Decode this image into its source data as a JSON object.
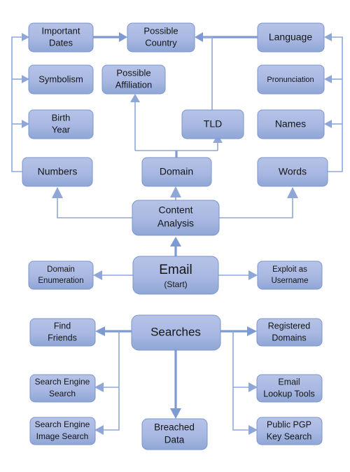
{
  "diagram": {
    "title": "Email OSINT Investigation Flowchart",
    "type": "flowchart",
    "background_color": "#ffffff",
    "node_fill_top": "#b3c1e6",
    "node_fill_bottom": "#93a9d7",
    "node_stroke": "#7b95cf",
    "connector_color": "#8fa7d6",
    "text_color": "#151515",
    "nodes": {
      "important_dates": {
        "label": "Important\nDates",
        "line1": "Important",
        "line2": "Dates"
      },
      "possible_country": {
        "label": "Possible\nCountry",
        "line1": "Possible",
        "line2": "Country"
      },
      "language": {
        "label": "Language",
        "line1": "Language",
        "line2": ""
      },
      "symbolism": {
        "label": "Symbolism",
        "line1": "Symbolism",
        "line2": ""
      },
      "possible_affiliation": {
        "label": "Possible\nAffiliation",
        "line1": "Possible",
        "line2": "Affiliation"
      },
      "pronunciation": {
        "label": "Pronunciation",
        "line1": "Pronunciation",
        "line2": ""
      },
      "birth_year": {
        "label": "Birth\nYear",
        "line1": "Birth",
        "line2": "Year"
      },
      "tld": {
        "label": "TLD",
        "line1": "TLD",
        "line2": ""
      },
      "names": {
        "label": "Names",
        "line1": "Names",
        "line2": ""
      },
      "numbers": {
        "label": "Numbers",
        "line1": "Numbers",
        "line2": ""
      },
      "domain": {
        "label": "Domain",
        "line1": "Domain",
        "line2": ""
      },
      "words": {
        "label": "Words",
        "line1": "Words",
        "line2": ""
      },
      "content_analysis": {
        "label": "Content\nAnalysis",
        "line1": "Content",
        "line2": "Analysis"
      },
      "domain_enumeration": {
        "label": "Domain\nEnumeration",
        "line1": "Domain",
        "line2": "Enumeration"
      },
      "email": {
        "label": "Email\n(Start)",
        "line1": "Email",
        "line2": "(Start)"
      },
      "exploit_as_username": {
        "label": "Exploit as\nUsername",
        "line1": "Exploit  as",
        "line2": "Username"
      },
      "find_friends": {
        "label": "Find\nFriends",
        "line1": "Find",
        "line2": "Friends"
      },
      "searches": {
        "label": "Searches",
        "line1": "Searches",
        "line2": ""
      },
      "registered_domains": {
        "label": "Registered\nDomains",
        "line1": "Registered",
        "line2": "Domains"
      },
      "search_engine_search": {
        "label": "Search Engine\nSearch",
        "line1": "Search Engine",
        "line2": "Search"
      },
      "email_lookup_tools": {
        "label": "Email\nLookup Tools",
        "line1": "Email",
        "line2": "Lookup Tools"
      },
      "search_engine_image_search": {
        "label": "Search Engine\nImage Search",
        "line1": "Search Engine",
        "line2": "Image Search"
      },
      "breached_data": {
        "label": "Breached\nData",
        "line1": "Breached",
        "line2": "Data"
      },
      "public_pgp_key_search": {
        "label": "Public PGP\nKey Search",
        "line1": "Public PGP",
        "line2": "Key Search"
      }
    },
    "edges": [
      {
        "from": "important_dates",
        "to": "possible_country"
      },
      {
        "from": "language",
        "to": "possible_country"
      },
      {
        "from": "tld",
        "to": "possible_country"
      },
      {
        "from": "numbers",
        "to": "important_dates"
      },
      {
        "from": "numbers",
        "to": "symbolism"
      },
      {
        "from": "numbers",
        "to": "birth_year"
      },
      {
        "from": "words",
        "to": "language"
      },
      {
        "from": "words",
        "to": "pronunciation"
      },
      {
        "from": "words",
        "to": "names"
      },
      {
        "from": "domain",
        "to": "possible_affiliation"
      },
      {
        "from": "domain",
        "to": "tld"
      },
      {
        "from": "content_analysis",
        "to": "numbers"
      },
      {
        "from": "content_analysis",
        "to": "domain"
      },
      {
        "from": "content_analysis",
        "to": "words"
      },
      {
        "from": "email",
        "to": "content_analysis"
      },
      {
        "from": "email",
        "to": "domain_enumeration"
      },
      {
        "from": "email",
        "to": "exploit_as_username"
      },
      {
        "from": "searches",
        "to": "find_friends"
      },
      {
        "from": "searches",
        "to": "search_engine_search"
      },
      {
        "from": "searches",
        "to": "search_engine_image_search"
      },
      {
        "from": "searches",
        "to": "breached_data"
      },
      {
        "from": "searches",
        "to": "registered_domains"
      },
      {
        "from": "searches",
        "to": "email_lookup_tools"
      },
      {
        "from": "searches",
        "to": "public_pgp_key_search"
      }
    ]
  }
}
